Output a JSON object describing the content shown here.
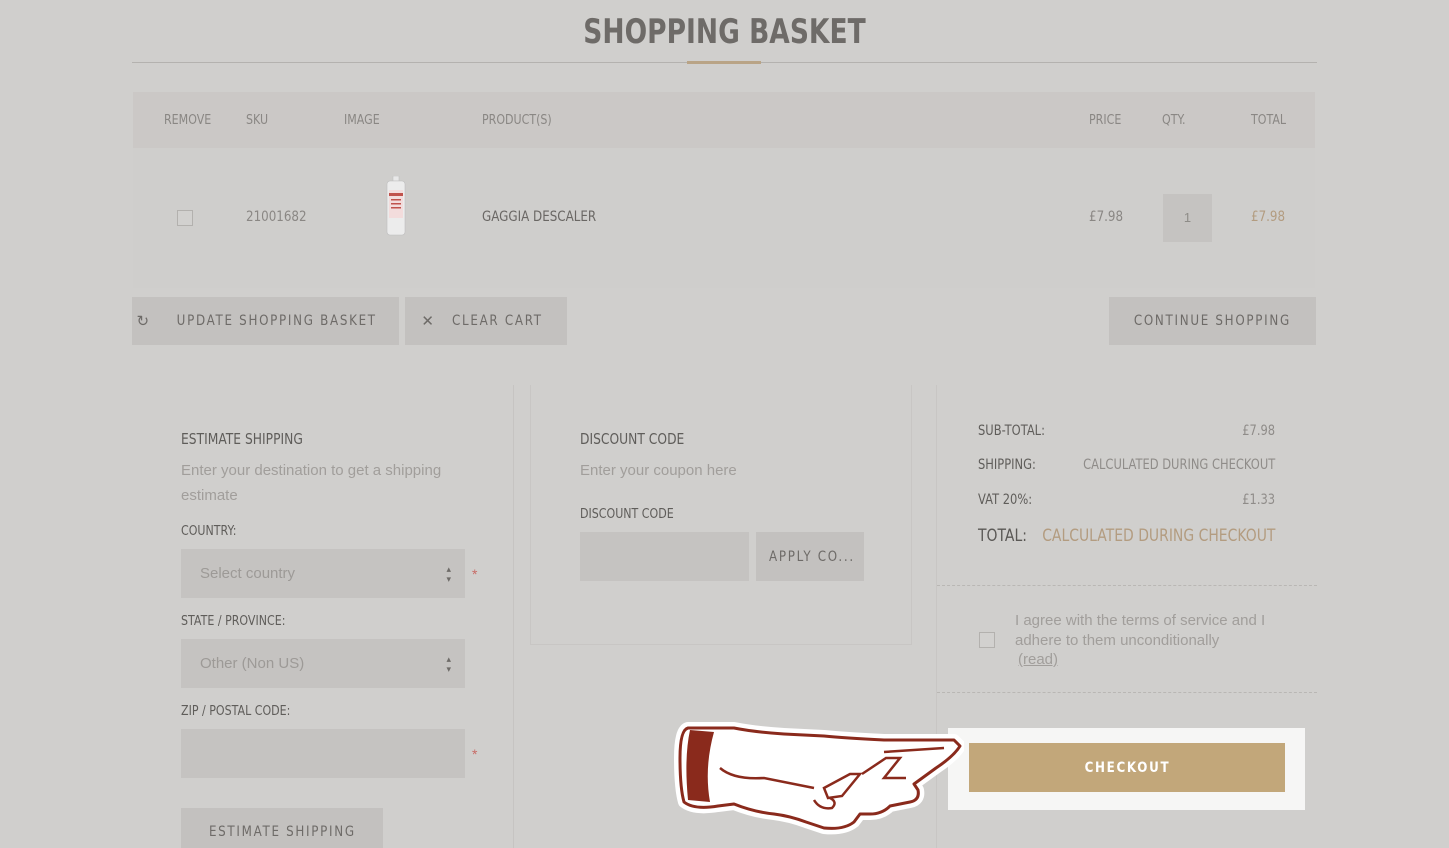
{
  "page": {
    "title": "SHOPPING BASKET"
  },
  "cart": {
    "columns": {
      "remove": "REMOVE",
      "sku": "SKU",
      "image": "IMAGE",
      "product": "PRODUCT(S)",
      "price": "PRICE",
      "qty": "QTY.",
      "total": "TOTAL"
    },
    "rows": [
      {
        "sku": "21001682",
        "product": "GAGGIA DESCALER",
        "price": "£7.98",
        "qty": "1",
        "total": "£7.98",
        "image_icon": "gaggia-descaler-bottle"
      }
    ]
  },
  "actions": {
    "update": "UPDATE SHOPPING BASKET",
    "update_icon": "refresh-icon",
    "clear": "CLEAR CART",
    "clear_icon": "close-icon",
    "continue": "CONTINUE SHOPPING"
  },
  "shipping": {
    "title": "ESTIMATE SHIPPING",
    "description": "Enter your destination to get a shipping estimate",
    "country_label": "COUNTRY:",
    "country_value": "Select country",
    "state_label": "STATE / PROVINCE:",
    "state_value": "Other (Non US)",
    "zip_label": "ZIP / POSTAL CODE:",
    "zip_value": "",
    "required_mark": "*",
    "button": "ESTIMATE SHIPPING"
  },
  "discount": {
    "title": "DISCOUNT CODE",
    "description": "Enter your coupon here",
    "label": "DISCOUNT CODE",
    "value": "",
    "button": "APPLY CO..."
  },
  "totals": {
    "subtotal_label": "SUB-TOTAL:",
    "subtotal_value": "£7.98",
    "shipping_label": "SHIPPING:",
    "shipping_value": "CALCULATED DURING CHECKOUT",
    "vat_label": "VAT 20%:",
    "vat_value": "£1.33",
    "total_label": "TOTAL:",
    "total_value": "CALCULATED DURING CHECKOUT"
  },
  "terms": {
    "text": "I agree with the terms of service and I adhere to them unconditionally",
    "read_link": "(read)"
  },
  "checkout": {
    "button": "CHECKOUT"
  },
  "overlay": {
    "pointer_icon": "pointing-hand-icon"
  },
  "colors": {
    "background": "#d0cfcd",
    "accent": "#c2a77a",
    "price_highlight": "#b39c80",
    "required": "#c86b66",
    "pointer_outline": "#8a2a1c"
  }
}
